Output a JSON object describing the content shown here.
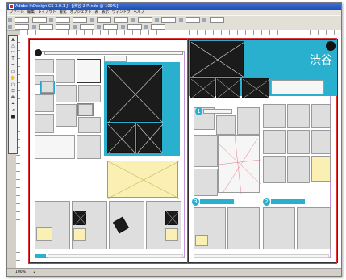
{
  "window": {
    "title": "Adobe InDesign CS 3.0.1 J - [渋谷 2 P.indd @ 100%]"
  },
  "menu": [
    "ファイル",
    "編集",
    "レイアウト",
    "書式",
    "オブジェクト",
    "表",
    "表示",
    "ウィンドウ",
    "ヘルプ"
  ],
  "spread": {
    "headline": "渋谷",
    "badge_text": "",
    "section_numbers": [
      "1",
      "3",
      "2"
    ]
  },
  "status": {
    "zoom": "100%",
    "page": "2"
  },
  "toolbox": {
    "tools": [
      "▲",
      "△",
      "✂",
      "T",
      "✒",
      "▭",
      "✋",
      "○",
      "⎕",
      "✥",
      "⌖",
      "↗",
      "■"
    ]
  }
}
